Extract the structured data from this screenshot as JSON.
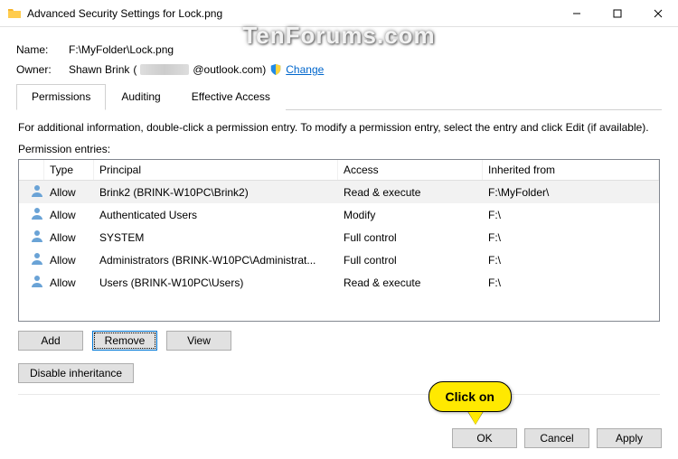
{
  "window": {
    "title": "Advanced Security Settings for Lock.png"
  },
  "watermark": "TenForums.com",
  "name": {
    "label": "Name:",
    "value": "F:\\MyFolder\\Lock.png"
  },
  "owner": {
    "label": "Owner:",
    "value_prefix": "Shawn Brink",
    "value_suffix": "@outlook.com)",
    "change": "Change"
  },
  "tabs": {
    "permissions": "Permissions",
    "auditing": "Auditing",
    "effective": "Effective Access"
  },
  "instruction": "For additional information, double-click a permission entry. To modify a permission entry, select the entry and click Edit (if available).",
  "entries_label": "Permission entries:",
  "cols": {
    "type": "Type",
    "principal": "Principal",
    "access": "Access",
    "inherited": "Inherited from"
  },
  "rows": [
    {
      "type": "Allow",
      "principal": "Brink2 (BRINK-W10PC\\Brink2)",
      "access": "Read & execute",
      "inherited": "F:\\MyFolder\\"
    },
    {
      "type": "Allow",
      "principal": "Authenticated Users",
      "access": "Modify",
      "inherited": "F:\\"
    },
    {
      "type": "Allow",
      "principal": "SYSTEM",
      "access": "Full control",
      "inherited": "F:\\"
    },
    {
      "type": "Allow",
      "principal": "Administrators (BRINK-W10PC\\Administrat...",
      "access": "Full control",
      "inherited": "F:\\"
    },
    {
      "type": "Allow",
      "principal": "Users (BRINK-W10PC\\Users)",
      "access": "Read & execute",
      "inherited": "F:\\"
    }
  ],
  "buttons": {
    "add": "Add",
    "remove": "Remove",
    "view": "View",
    "disable": "Disable inheritance",
    "ok": "OK",
    "cancel": "Cancel",
    "apply": "Apply"
  },
  "callout": "Click on"
}
